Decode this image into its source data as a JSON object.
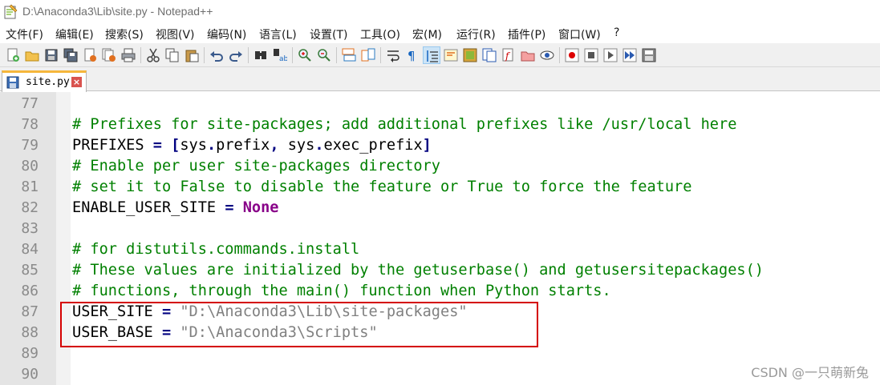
{
  "window": {
    "title": "D:\\Anaconda3\\Lib\\site.py - Notepad++"
  },
  "menu": [
    "文件(F)",
    "编辑(E)",
    "搜索(S)",
    "视图(V)",
    "编码(N)",
    "语言(L)",
    "设置(T)",
    "工具(O)",
    "宏(M)",
    "运行(R)",
    "插件(P)",
    "窗口(W)",
    "?"
  ],
  "toolbar": {
    "icons": [
      "new-file-icon",
      "open-file-icon",
      "save-icon",
      "save-all-icon",
      "close-icon",
      "close-all-icon",
      "print-icon",
      "cut-icon",
      "copy-icon",
      "paste-icon",
      "undo-icon",
      "redo-icon",
      "find-icon",
      "replace-icon",
      "zoom-in-icon",
      "zoom-out-icon",
      "sync-vertical-icon",
      "sync-horizontal-icon",
      "word-wrap-icon",
      "show-all-chars-icon",
      "indent-guide-icon",
      "udl-icon",
      "doc-map-icon",
      "function-list-icon",
      "folder-workspace-icon",
      "monitor-icon",
      "record-macro-icon",
      "stop-macro-icon",
      "play-macro-icon",
      "play-multiple-icon",
      "save-macro-icon"
    ]
  },
  "tab": {
    "label": "site.py",
    "close": "×"
  },
  "editor": {
    "lines": [
      {
        "num": "77",
        "tokens": []
      },
      {
        "num": "78",
        "tokens": [
          {
            "t": "# Prefixes for site-packages; add additional prefixes like /usr/local here",
            "c": "cmt"
          }
        ]
      },
      {
        "num": "79",
        "tokens": [
          {
            "t": "PREFIXES ",
            "c": "id"
          },
          {
            "t": "=",
            "c": "op"
          },
          {
            "t": " ",
            "c": "id"
          },
          {
            "t": "[",
            "c": "op"
          },
          {
            "t": "sys",
            "c": "id"
          },
          {
            "t": ".",
            "c": "op"
          },
          {
            "t": "prefix",
            "c": "id"
          },
          {
            "t": ",",
            "c": "op"
          },
          {
            "t": " sys",
            "c": "id"
          },
          {
            "t": ".",
            "c": "op"
          },
          {
            "t": "exec_prefix",
            "c": "id"
          },
          {
            "t": "]",
            "c": "op"
          }
        ]
      },
      {
        "num": "80",
        "tokens": [
          {
            "t": "# Enable per user site-packages directory",
            "c": "cmt"
          }
        ]
      },
      {
        "num": "81",
        "tokens": [
          {
            "t": "# set it to False to disable the feature or True to force the feature",
            "c": "cmt"
          }
        ]
      },
      {
        "num": "82",
        "tokens": [
          {
            "t": "ENABLE_USER_SITE ",
            "c": "id"
          },
          {
            "t": "=",
            "c": "op"
          },
          {
            "t": " ",
            "c": "id"
          },
          {
            "t": "None",
            "c": "kw"
          }
        ]
      },
      {
        "num": "83",
        "tokens": []
      },
      {
        "num": "84",
        "tokens": [
          {
            "t": "# for distutils.commands.install",
            "c": "cmt"
          }
        ]
      },
      {
        "num": "85",
        "tokens": [
          {
            "t": "# These values are initialized by the getuserbase() and getusersitepackages()",
            "c": "cmt"
          }
        ]
      },
      {
        "num": "86",
        "tokens": [
          {
            "t": "# functions, through the main() function when Python starts.",
            "c": "cmt"
          }
        ]
      },
      {
        "num": "87",
        "tokens": [
          {
            "t": "USER_SITE ",
            "c": "id"
          },
          {
            "t": "=",
            "c": "op"
          },
          {
            "t": " ",
            "c": "id"
          },
          {
            "t": "\"D:\\Anaconda3\\Lib\\site-packages\"",
            "c": "str"
          }
        ]
      },
      {
        "num": "88",
        "tokens": [
          {
            "t": "USER_BASE ",
            "c": "id"
          },
          {
            "t": "=",
            "c": "op"
          },
          {
            "t": " ",
            "c": "id"
          },
          {
            "t": "\"D:\\Anaconda3\\Scripts\"",
            "c": "str"
          }
        ]
      },
      {
        "num": "89",
        "tokens": []
      },
      {
        "num": "90",
        "tokens": []
      }
    ]
  },
  "watermark": "CSDN @一只萌新兔"
}
